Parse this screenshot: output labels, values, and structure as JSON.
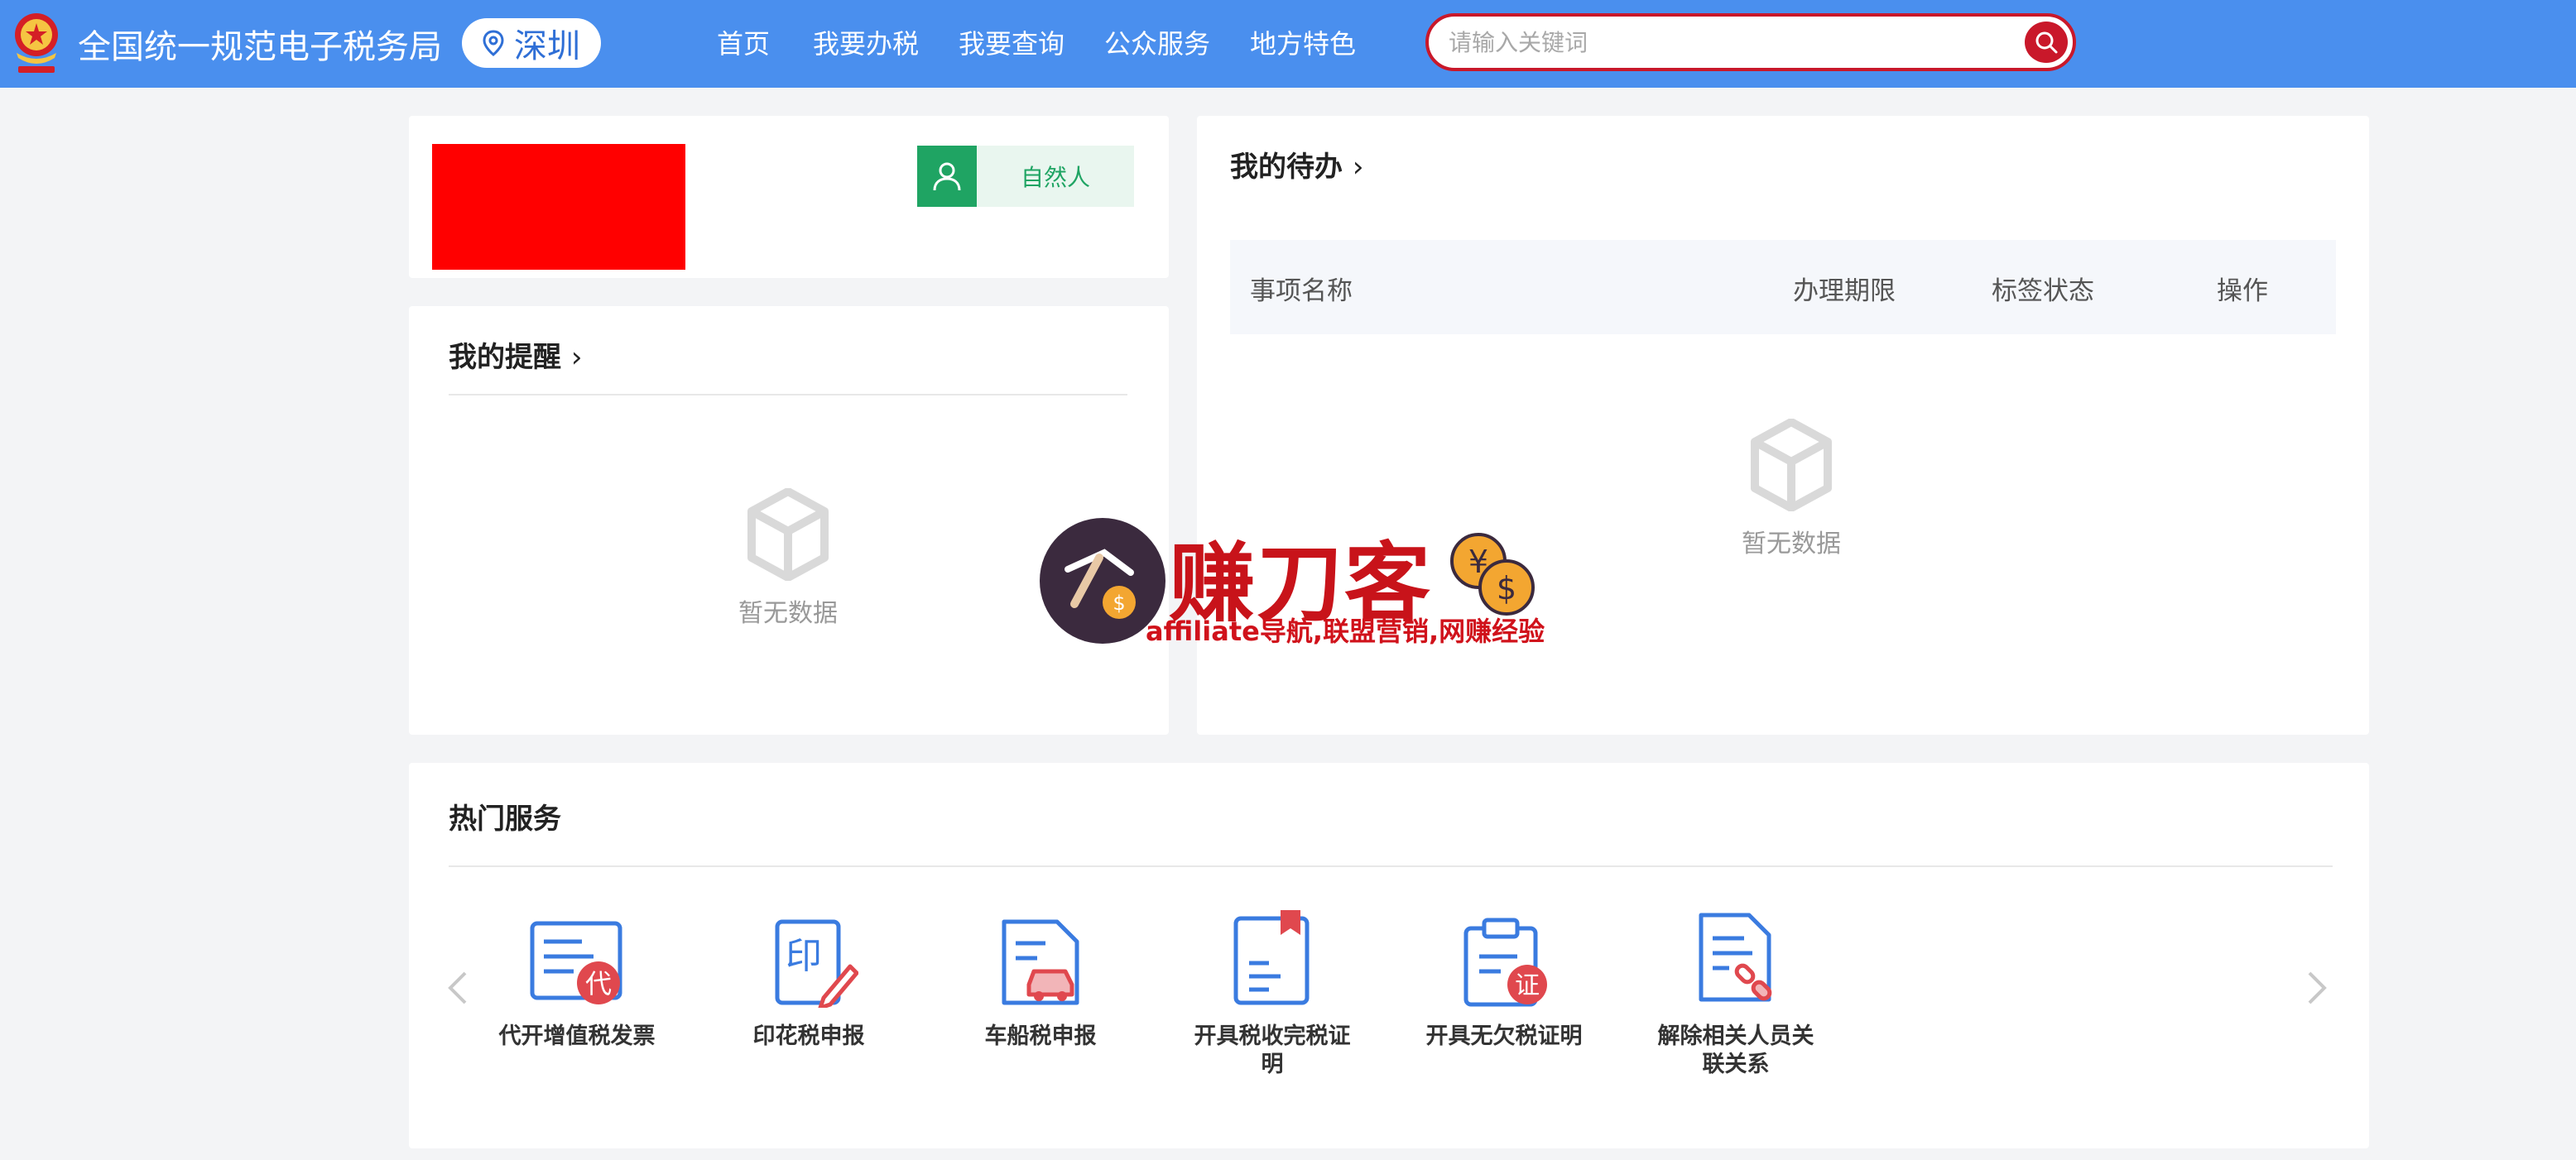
{
  "header": {
    "site_title": "全国统一规范电子税务局",
    "city": "深圳",
    "nav": [
      "首页",
      "我要办税",
      "我要查询",
      "公众服务",
      "地方特色"
    ],
    "search_placeholder": "请输入关键词",
    "bar_color": "#4a8fee",
    "search_accent": "#c9182a"
  },
  "profile": {
    "role_label": "自然人",
    "redacted_color": "#ff0000"
  },
  "reminders": {
    "title": "我的提醒",
    "empty_text": "暂无数据"
  },
  "todo": {
    "title": "我的待办",
    "columns": [
      "事项名称",
      "办理期限",
      "标签状态",
      "操作"
    ],
    "empty_text": "暂无数据"
  },
  "hot_services": {
    "title": "热门服务",
    "items": [
      {
        "label": "代开增值税发票",
        "icon": "invoice-dai-icon"
      },
      {
        "label": "印花税申报",
        "icon": "stamp-tax-icon"
      },
      {
        "label": "车船税申报",
        "icon": "vehicle-tax-icon"
      },
      {
        "label": "开具税收完税证明",
        "icon": "tax-certificate-icon"
      },
      {
        "label": "开具无欠税证明",
        "icon": "no-arrears-certificate-icon"
      },
      {
        "label": "解除相关人员关联关系",
        "icon": "unlink-relation-icon"
      }
    ]
  },
  "watermark": {
    "main": "赚刀客",
    "sub": "affiliate导航,联盟营销,网赚经验"
  }
}
